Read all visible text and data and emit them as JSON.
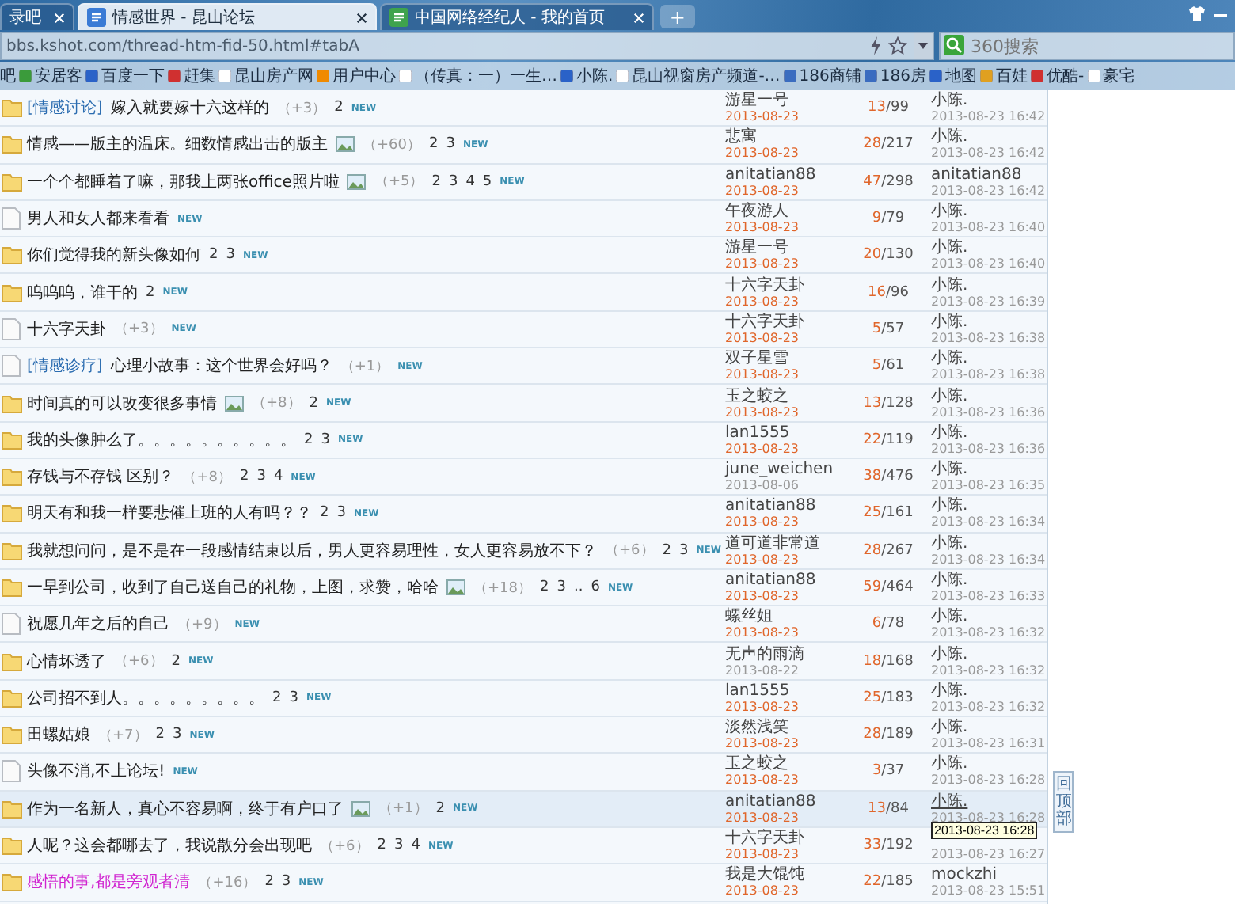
{
  "browser": {
    "tabs": [
      {
        "label": "录吧",
        "selected": false
      },
      {
        "label": "情感世界 - 昆山论坛",
        "selected": true
      },
      {
        "label": "中国网络经纪人 - 我的首页",
        "selected": false
      }
    ],
    "new_tab": "+",
    "address": "bbs.kshot.com/thread-htm-fid-50.html#tabA",
    "search": {
      "placeholder": "360搜索"
    },
    "bookmarks": [
      "吧",
      "安居客",
      "百度一下",
      "赶集",
      "昆山房产网",
      "用户中心",
      "（传真：一）一生…",
      "小陈.",
      "昆山视窗房产频道-…",
      "186商铺",
      "186房",
      "地图",
      "百娃",
      "优酷-",
      "豪宅"
    ]
  },
  "threads": [
    {
      "kind": "folder",
      "tag": "[情感讨论]",
      "title": "嫁入就要嫁十六这样的",
      "highlighted": false,
      "image": false,
      "extra": "（+3）",
      "pages": [
        "2"
      ],
      "new": "NEW",
      "author": "游星一号",
      "date": "2013-08-23",
      "fresh": true,
      "replies": "13",
      "views": "/99",
      "last_by": "小陈.",
      "last_time": "2013-08-23 16:42",
      "hovered": false
    },
    {
      "kind": "folder",
      "title": "情感——版主的温床。细数情感出击的版主",
      "highlighted": false,
      "image": true,
      "extra": "（+60）",
      "pages": [
        "2",
        "3"
      ],
      "new": "NEW",
      "author": "悲寓",
      "date": "2013-08-23",
      "fresh": true,
      "replies": "28",
      "views": "/217",
      "last_by": "小陈.",
      "last_time": "2013-08-23 16:42",
      "hovered": false
    },
    {
      "kind": "folder",
      "title": "一个个都睡着了嘛，那我上两张office照片啦",
      "highlighted": false,
      "image": true,
      "extra": "（+5）",
      "pages": [
        "2",
        "3",
        "4",
        "5"
      ],
      "new": "NEW",
      "author": "anitatian88",
      "date": "2013-08-23",
      "fresh": true,
      "replies": "47",
      "views": "/298",
      "last_by": "anitatian88",
      "last_time": "2013-08-23 16:42",
      "hovered": false
    },
    {
      "kind": "page",
      "title": "男人和女人都来看看",
      "highlighted": false,
      "image": false,
      "new": "NEW",
      "author": "午夜游人",
      "date": "2013-08-23",
      "fresh": true,
      "replies": "9",
      "views": "/79",
      "last_by": "小陈.",
      "last_time": "2013-08-23 16:40",
      "hovered": false
    },
    {
      "kind": "folder",
      "title": "你们觉得我的新头像如何",
      "highlighted": false,
      "image": false,
      "pages": [
        "2",
        "3"
      ],
      "new": "NEW",
      "author": "游星一号",
      "date": "2013-08-23",
      "fresh": true,
      "replies": "20",
      "views": "/130",
      "last_by": "小陈.",
      "last_time": "2013-08-23 16:40",
      "hovered": false
    },
    {
      "kind": "folder",
      "title": "呜呜呜，谁干的",
      "highlighted": false,
      "image": false,
      "pages": [
        "2"
      ],
      "new": "NEW",
      "author": "十六字天卦",
      "date": "2013-08-23",
      "fresh": true,
      "replies": "16",
      "views": "/96",
      "last_by": "小陈.",
      "last_time": "2013-08-23 16:39",
      "hovered": false
    },
    {
      "kind": "page",
      "title": "十六字天卦",
      "highlighted": false,
      "image": false,
      "extra": "（+3）",
      "new": "NEW",
      "author": "十六字天卦",
      "date": "2013-08-23",
      "fresh": true,
      "replies": "5",
      "views": "/57",
      "last_by": "小陈.",
      "last_time": "2013-08-23 16:38",
      "hovered": false
    },
    {
      "kind": "page",
      "tag": "[情感诊疗]",
      "title": "心理小故事：这个世界会好吗？",
      "highlighted": false,
      "image": false,
      "extra": "（+1）",
      "new": "NEW",
      "author": "双子星雪",
      "date": "2013-08-23",
      "fresh": true,
      "replies": "5",
      "views": "/61",
      "last_by": "小陈.",
      "last_time": "2013-08-23 16:38",
      "hovered": false
    },
    {
      "kind": "folder",
      "title": "时间真的可以改变很多事情",
      "highlighted": false,
      "image": true,
      "extra": "（+8）",
      "pages": [
        "2"
      ],
      "new": "NEW",
      "author": "玉之蛟之",
      "date": "2013-08-23",
      "fresh": true,
      "replies": "13",
      "views": "/128",
      "last_by": "小陈.",
      "last_time": "2013-08-23 16:36",
      "hovered": false
    },
    {
      "kind": "folder",
      "title": "我的头像肿么了。。。。。。。。。。",
      "highlighted": false,
      "image": false,
      "pages": [
        "2",
        "3"
      ],
      "new": "NEW",
      "author": "lan1555",
      "date": "2013-08-23",
      "fresh": true,
      "replies": "22",
      "views": "/119",
      "last_by": "小陈.",
      "last_time": "2013-08-23 16:36",
      "hovered": false
    },
    {
      "kind": "folder",
      "title": "存钱与不存钱 区别？",
      "highlighted": false,
      "image": false,
      "extra": "（+8）",
      "pages": [
        "2",
        "3",
        "4"
      ],
      "new": "NEW",
      "author": "june_weichen",
      "date": "2013-08-06",
      "fresh": false,
      "replies": "38",
      "views": "/476",
      "last_by": "小陈.",
      "last_time": "2013-08-23 16:35",
      "hovered": false
    },
    {
      "kind": "folder",
      "title": "明天有和我一样要悲催上班的人有吗？？",
      "highlighted": false,
      "image": false,
      "pages": [
        "2",
        "3"
      ],
      "new": "NEW",
      "author": "anitatian88",
      "date": "2013-08-23",
      "fresh": true,
      "replies": "25",
      "views": "/161",
      "last_by": "小陈.",
      "last_time": "2013-08-23 16:34",
      "hovered": false
    },
    {
      "kind": "folder",
      "title": "我就想问问，是不是在一段感情结束以后，男人更容易理性，女人更容易放不下？",
      "highlighted": false,
      "image": false,
      "extra": "（+6）",
      "pages": [
        "2",
        "3"
      ],
      "new": "NEW",
      "author": "道可道非常道",
      "date": "2013-08-23",
      "fresh": true,
      "replies": "28",
      "views": "/267",
      "last_by": "小陈.",
      "last_time": "2013-08-23 16:34",
      "hovered": false
    },
    {
      "kind": "folder",
      "title": "一早到公司，收到了自己送自己的礼物，上图，求赞，哈哈",
      "highlighted": false,
      "image": true,
      "extra": "（+18）",
      "pages": [
        "2",
        "3",
        "..",
        "6"
      ],
      "new": "NEW",
      "author": "anitatian88",
      "date": "2013-08-23",
      "fresh": true,
      "replies": "59",
      "views": "/464",
      "last_by": "小陈.",
      "last_time": "2013-08-23 16:33",
      "hovered": false
    },
    {
      "kind": "page",
      "title": "祝愿几年之后的自己",
      "highlighted": false,
      "image": false,
      "extra": "（+9）",
      "new": "NEW",
      "author": "螺丝姐",
      "date": "2013-08-23",
      "fresh": true,
      "replies": "6",
      "views": "/78",
      "last_by": "小陈.",
      "last_time": "2013-08-23 16:32",
      "hovered": false
    },
    {
      "kind": "folder",
      "title": "心情坏透了",
      "highlighted": false,
      "image": false,
      "extra": "（+6）",
      "pages": [
        "2"
      ],
      "new": "NEW",
      "author": "无声的雨滴",
      "date": "2013-08-22",
      "fresh": false,
      "replies": "18",
      "views": "/168",
      "last_by": "小陈.",
      "last_time": "2013-08-23 16:32",
      "hovered": false
    },
    {
      "kind": "folder",
      "title": "公司招不到人。。。。。。。。。",
      "highlighted": false,
      "image": false,
      "pages": [
        "2",
        "3"
      ],
      "new": "NEW",
      "author": "lan1555",
      "date": "2013-08-23",
      "fresh": true,
      "replies": "25",
      "views": "/183",
      "last_by": "小陈.",
      "last_time": "2013-08-23 16:32",
      "hovered": false
    },
    {
      "kind": "folder",
      "title": "田螺姑娘",
      "highlighted": false,
      "image": false,
      "extra": "（+7）",
      "pages": [
        "2",
        "3"
      ],
      "new": "NEW",
      "author": "淡然浅笑",
      "date": "2013-08-23",
      "fresh": true,
      "replies": "28",
      "views": "/189",
      "last_by": "小陈.",
      "last_time": "2013-08-23 16:31",
      "hovered": false
    },
    {
      "kind": "page",
      "title": "头像不消,不上论坛!",
      "highlighted": false,
      "image": false,
      "new": "NEW",
      "author": "玉之蛟之",
      "date": "2013-08-23",
      "fresh": true,
      "replies": "3",
      "views": "/37",
      "last_by": "小陈.",
      "last_time": "2013-08-23 16:28",
      "hovered": false
    },
    {
      "kind": "folder",
      "title": "作为一名新人，真心不容易啊，终于有户口了",
      "highlighted": false,
      "image": true,
      "extra": "（+1）",
      "pages": [
        "2"
      ],
      "new": "NEW",
      "author": "anitatian88",
      "date": "2013-08-23",
      "fresh": true,
      "replies": "13",
      "views": "/84",
      "last_by": "小陈.",
      "last_time": "2013-08-23 16:28",
      "hovered": true
    },
    {
      "kind": "folder",
      "title": "人呢？这会都哪去了，我说散分会出现吧",
      "highlighted": false,
      "image": false,
      "extra": "（+6）",
      "pages": [
        "2",
        "3",
        "4"
      ],
      "new": "NEW",
      "author": "十六字天卦",
      "date": "2013-08-23",
      "fresh": true,
      "replies": "33",
      "views": "/192",
      "last_time": "2013-08-23 16:27",
      "hovered": false
    },
    {
      "kind": "folder",
      "title": "感悟的事,都是旁观者清",
      "highlighted": true,
      "image": false,
      "extra": "（+16）",
      "pages": [
        "2",
        "3"
      ],
      "new": "NEW",
      "author": "我是大馄饨",
      "date": "2013-08-23",
      "fresh": true,
      "replies": "22",
      "views": "/185",
      "last_by": "mockzhi",
      "last_time": "2013-08-23 15:51",
      "hovered": false
    }
  ],
  "tooltip": "2013-08-23 16:28",
  "back_to_top": "回顶部"
}
